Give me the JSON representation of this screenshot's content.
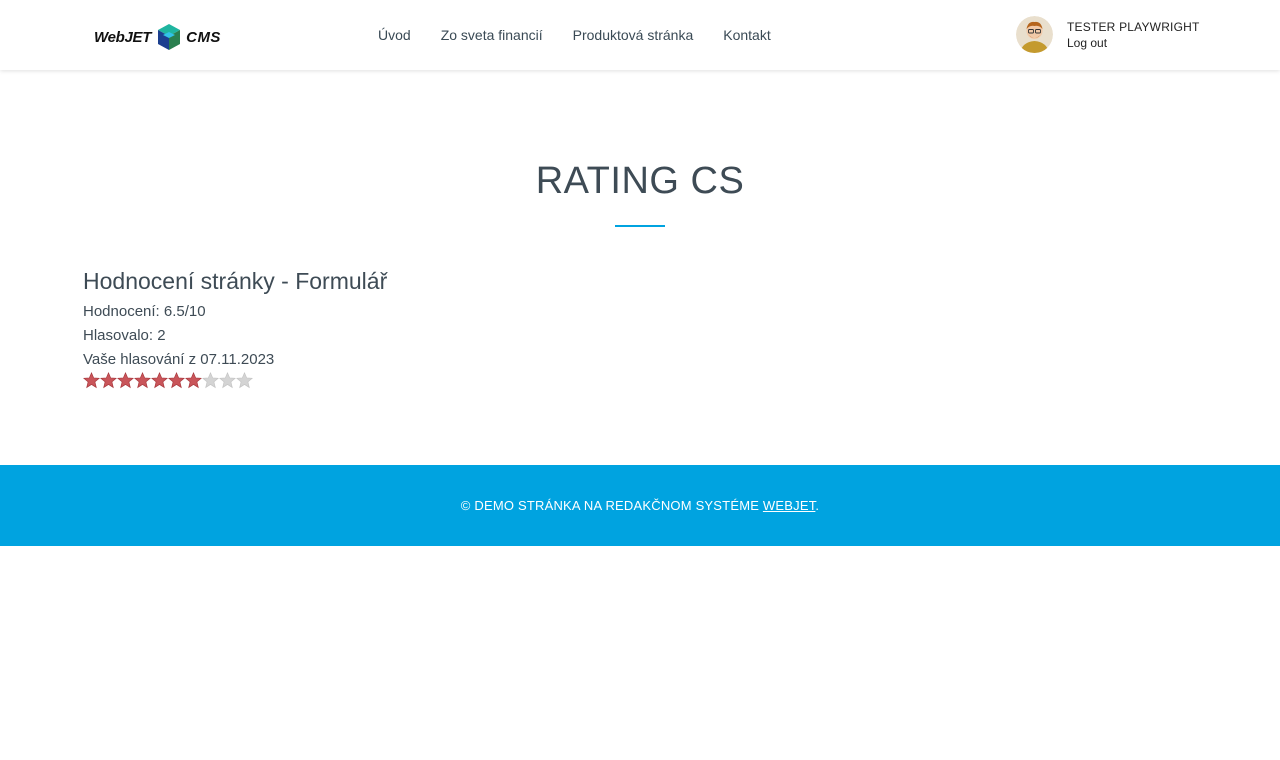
{
  "header": {
    "logo": {
      "text_part1": "WebJET",
      "text_part2": "CMS"
    },
    "nav": [
      {
        "label": "Úvod"
      },
      {
        "label": "Zo sveta financií"
      },
      {
        "label": "Produktová stránka"
      },
      {
        "label": "Kontakt"
      }
    ],
    "user": {
      "name": "TESTER PLAYWRIGHT",
      "logout_label": "Log out"
    }
  },
  "main": {
    "title": "RATING CS",
    "rating": {
      "heading": "Hodnocení stránky - Formulář",
      "score_text": "Hodnocení: 6.5/10",
      "votes_text": "Hlasovalo: 2",
      "your_vote_text": "Vaše hlasování z 07.11.2023",
      "stars_filled": 7,
      "stars_total": 10,
      "star_filled_color": "#c9555a",
      "star_empty_color": "#d4d4d4"
    }
  },
  "footer": {
    "text": "© DEMO STRÁNKA NA REDAKČNOM SYSTÉME ",
    "link_label": "WEBJET",
    "suffix": ".",
    "background_color": "#00a3e0"
  }
}
